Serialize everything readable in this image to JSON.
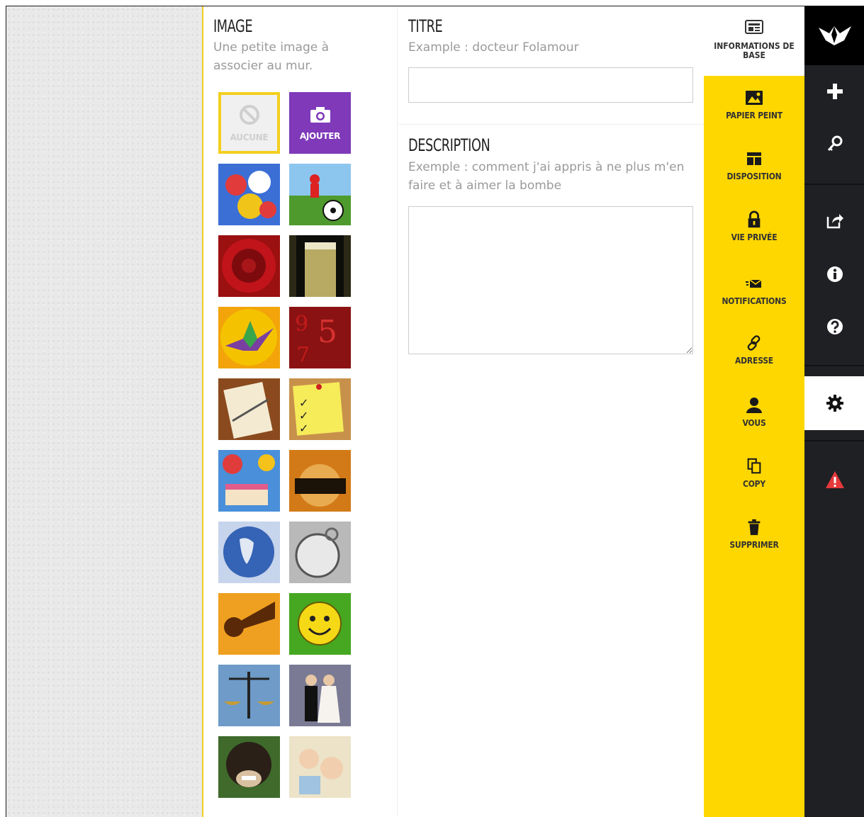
{
  "image_section": {
    "heading": "IMAGE",
    "hint": "Une petite image à associer au mur.",
    "none_label": "AUCUNE",
    "add_label": "AJOUTER",
    "thumbnails": [
      {
        "name": "thumb-balloons",
        "color": "#3b6fd6"
      },
      {
        "name": "thumb-soccer",
        "color": "#4e9a2d"
      },
      {
        "name": "thumb-rose",
        "color": "#9b1010"
      },
      {
        "name": "thumb-champagne",
        "color": "#2c2a16"
      },
      {
        "name": "thumb-origami",
        "color": "#f2a40a"
      },
      {
        "name": "thumb-numbers",
        "color": "#8a1212"
      },
      {
        "name": "thumb-notebook",
        "color": "#8a4a1e"
      },
      {
        "name": "thumb-checklist",
        "color": "#c8914b"
      },
      {
        "name": "thumb-birthday",
        "color": "#d33a6a"
      },
      {
        "name": "thumb-crowd",
        "color": "#c16a12"
      },
      {
        "name": "thumb-globe",
        "color": "#2e55a8"
      },
      {
        "name": "thumb-watch",
        "color": "#8e8e8e"
      },
      {
        "name": "thumb-megaphone",
        "color": "#e48b12"
      },
      {
        "name": "thumb-smiley",
        "color": "#3fa21a"
      },
      {
        "name": "thumb-scales",
        "color": "#3b6b9e"
      },
      {
        "name": "thumb-wedding",
        "color": "#6a6a86"
      },
      {
        "name": "thumb-chimp",
        "color": "#2b2b2b"
      },
      {
        "name": "thumb-babies",
        "color": "#d9ccb0"
      }
    ]
  },
  "title_section": {
    "heading": "TITRE",
    "hint": "Example : docteur Folamour",
    "value": ""
  },
  "description_section": {
    "heading": "DESCRIPTION",
    "hint": "Exemple : comment j'ai appris à ne plus m'en faire et à aimer la bombe",
    "value": ""
  },
  "settings_menu": {
    "items": [
      {
        "label": "INFORMATIONS DE BASE",
        "icon": "info-card-icon"
      },
      {
        "label": "PAPIER PEINT",
        "icon": "wallpaper-icon"
      },
      {
        "label": "DISPOSITION",
        "icon": "layout-icon"
      },
      {
        "label": "VIE PRIVÉE",
        "icon": "lock-icon"
      },
      {
        "label": "NOTIFICATIONS",
        "icon": "envelope-icon"
      },
      {
        "label": "ADRESSE",
        "icon": "link-icon"
      },
      {
        "label": "VOUS",
        "icon": "user-icon"
      },
      {
        "label": "COPY",
        "icon": "copy-icon"
      },
      {
        "label": "SUPPRIMER",
        "icon": "trash-icon"
      }
    ]
  },
  "rail": {
    "icons": [
      "crane-logo-icon",
      "plus-icon",
      "key-icon",
      "share-icon",
      "info-icon",
      "help-icon",
      "gear-icon",
      "warning-icon"
    ]
  },
  "colors": {
    "accent_yellow": "#ffd700",
    "add_purple": "#7f39b9",
    "rail_dark": "#1f2023",
    "warning_red": "#e5393b"
  }
}
